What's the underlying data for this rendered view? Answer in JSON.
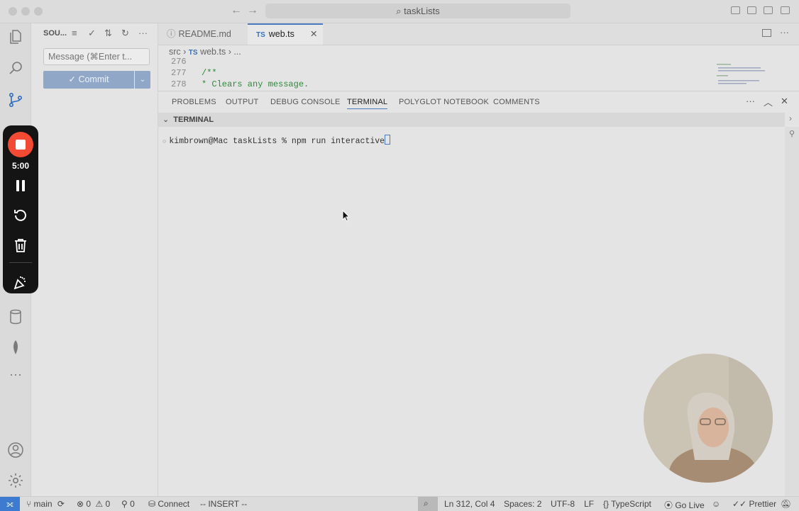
{
  "window": {
    "title": "taskLists"
  },
  "sidebar": {
    "title": "SOU...",
    "message_placeholder": "Message (⌘Enter t...",
    "commit_label": "Commit",
    "commit_check": "✓"
  },
  "editor": {
    "tabs": [
      {
        "label": "README.md",
        "icon": "ⓘ"
      },
      {
        "label": "web.ts",
        "icon": "TS"
      }
    ],
    "breadcrumb": {
      "folder": "src",
      "file_icon": "TS",
      "file": "web.ts",
      "more": "..."
    },
    "code_lines": [
      {
        "num": "276",
        "text": ""
      },
      {
        "num": "277",
        "text": "/**"
      },
      {
        "num": "278",
        "text": " * Clears any message."
      }
    ]
  },
  "panel": {
    "tabs": [
      "PROBLEMS",
      "OUTPUT",
      "DEBUG CONSOLE",
      "TERMINAL",
      "POLYGLOT NOTEBOOK",
      "COMMENTS"
    ],
    "active_tab": "TERMINAL",
    "section_title": "TERMINAL",
    "terminal_line": "kimbrown@Mac taskLists % npm run interactive"
  },
  "recorder": {
    "time": "5:00"
  },
  "statusbar": {
    "branch": "main",
    "errors": "0",
    "warnings": "0",
    "ports": "0",
    "connect": "Connect",
    "mode": "-- INSERT --",
    "position": "Ln 312, Col 4",
    "spaces": "Spaces: 2",
    "encoding": "UTF-8",
    "eol": "LF",
    "language": "TypeScript",
    "golive": "Go Live",
    "prettier": "Prettier"
  }
}
